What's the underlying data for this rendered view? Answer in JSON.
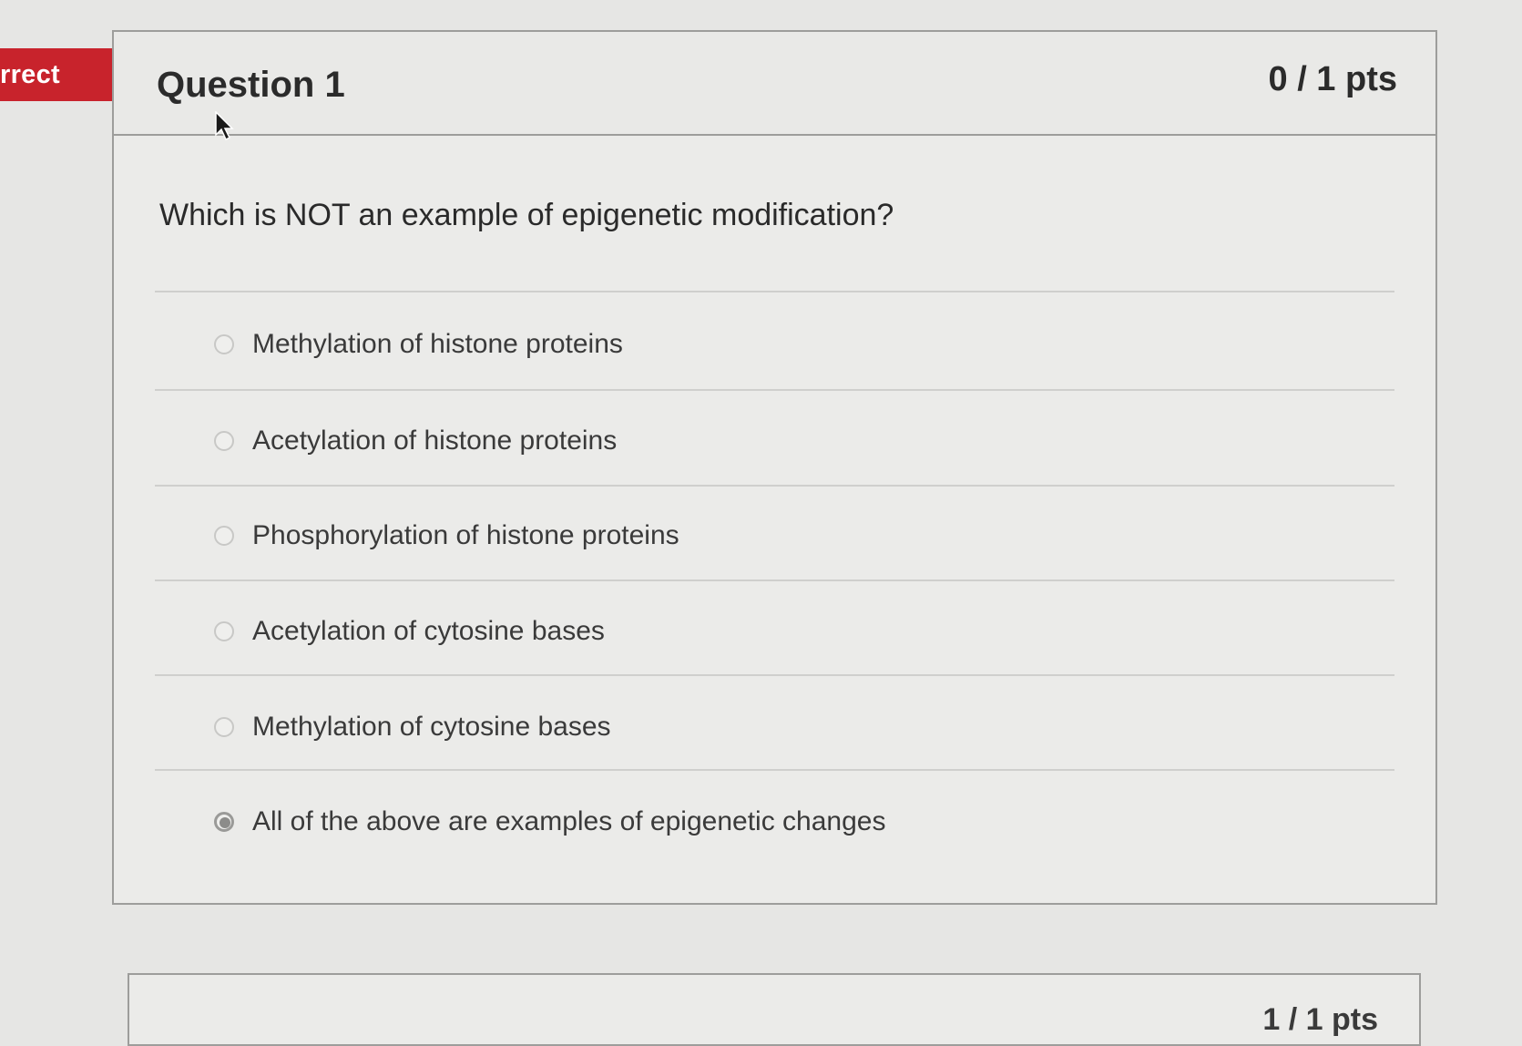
{
  "badge": {
    "label": "rrect"
  },
  "question": {
    "title": "Question 1",
    "points": "0 / 1 pts",
    "text": "Which is NOT an example of epigenetic modification?",
    "answers": [
      {
        "label": "Methylation of histone proteins",
        "selected": false
      },
      {
        "label": "Acetylation of histone proteins",
        "selected": false
      },
      {
        "label": "Phosphorylation of histone proteins",
        "selected": false
      },
      {
        "label": "Acetylation of cytosine bases",
        "selected": false
      },
      {
        "label": "Methylation of cytosine bases",
        "selected": false
      },
      {
        "label": "All of the above are examples of epigenetic changes",
        "selected": true
      }
    ]
  },
  "next_question": {
    "points": "1 / 1 pts"
  },
  "colors": {
    "incorrect_flag": "#c8232c",
    "page_bg": "#e6e6e4",
    "border": "#9d9d9b"
  }
}
